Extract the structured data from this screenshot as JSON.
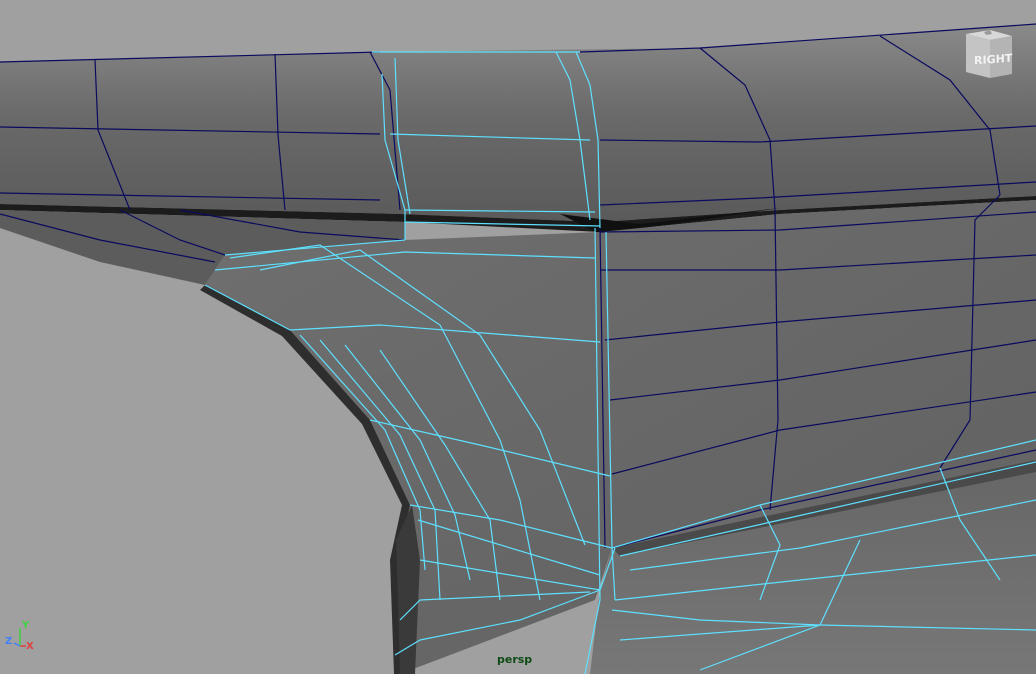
{
  "viewport": {
    "camera_label": "persp",
    "viewcube_label": "RIGHT",
    "axis": {
      "x_label": "X",
      "y_label": "Y",
      "z_label": "Z"
    }
  },
  "colors": {
    "background": "#a0a0a0",
    "surface": "#6e6e6e",
    "edge_default": "#0a0a5e",
    "edge_selected": "#5ee0ff",
    "camera_label": "#0e4a12",
    "axis_x": "#e04040",
    "axis_y": "#40d040",
    "axis_z": "#4080ff"
  }
}
